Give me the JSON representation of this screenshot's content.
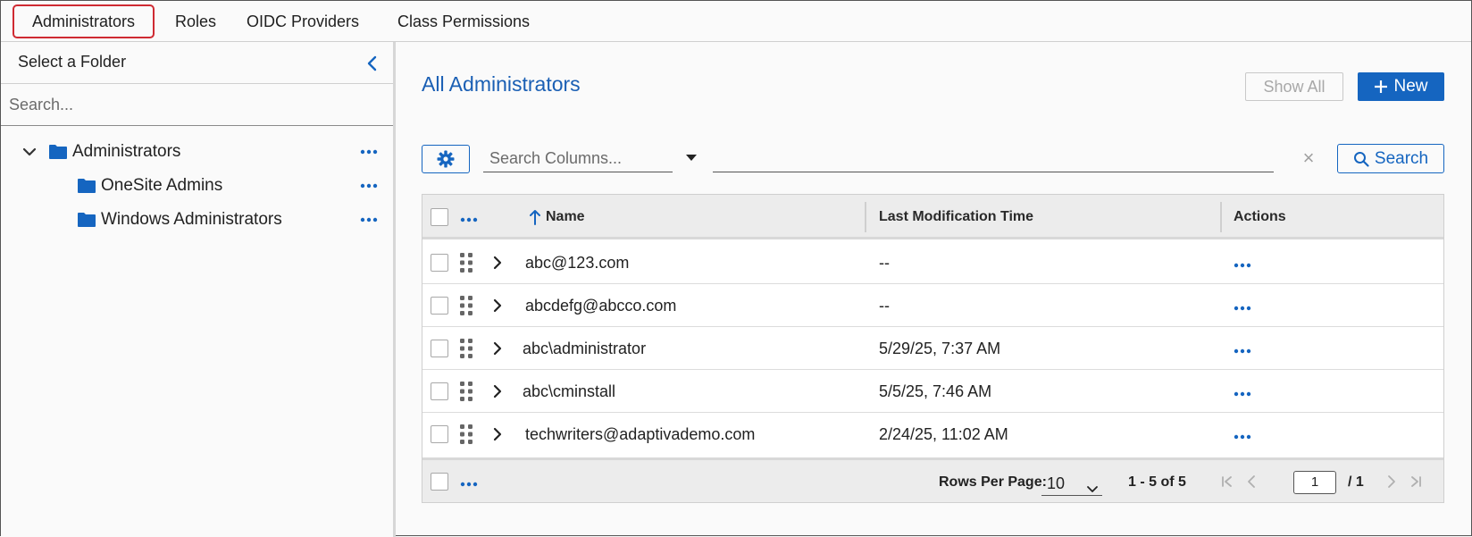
{
  "tabs": [
    {
      "label": "Administrators",
      "active": true
    },
    {
      "label": "Roles",
      "active": false
    },
    {
      "label": "OIDC Providers",
      "active": false
    },
    {
      "label": "Class Permissions",
      "active": false
    }
  ],
  "sidebar": {
    "heading": "Select a Folder",
    "search_placeholder": "Search...",
    "tree": [
      {
        "label": "Administrators",
        "expanded": true
      },
      {
        "label": "OneSite Admins"
      },
      {
        "label": "Windows Administrators"
      }
    ]
  },
  "main": {
    "title": "All Administrators",
    "show_all_label": "Show All",
    "new_label": "New",
    "search_columns_placeholder": "Search Columns...",
    "clear_symbol": "×",
    "search_label": "Search"
  },
  "table": {
    "columns": [
      "Name",
      "Last Modification Time",
      "Actions"
    ],
    "rows": [
      {
        "name": "abc@123.com",
        "modified": "--"
      },
      {
        "name": "abcdefg@abcco.com",
        "modified": "--"
      },
      {
        "name": "abc\\administrator",
        "modified": "5/29/25, 7:37 AM"
      },
      {
        "name": "abc\\cminstall",
        "modified": "5/5/25, 7:46 AM"
      },
      {
        "name": "techwriters@adaptivademo.com",
        "modified": "2/24/25, 11:02 AM"
      }
    ],
    "footer": {
      "rows_per_page_label": "Rows Per Page:",
      "rows_per_page": "10",
      "range": "1 - 5 of 5",
      "page": "1",
      "total_pages": "/ 1"
    }
  },
  "colors": {
    "accent": "#1565c0",
    "title": "#1a5fb4",
    "active_tab_outline": "#cf2a32"
  }
}
